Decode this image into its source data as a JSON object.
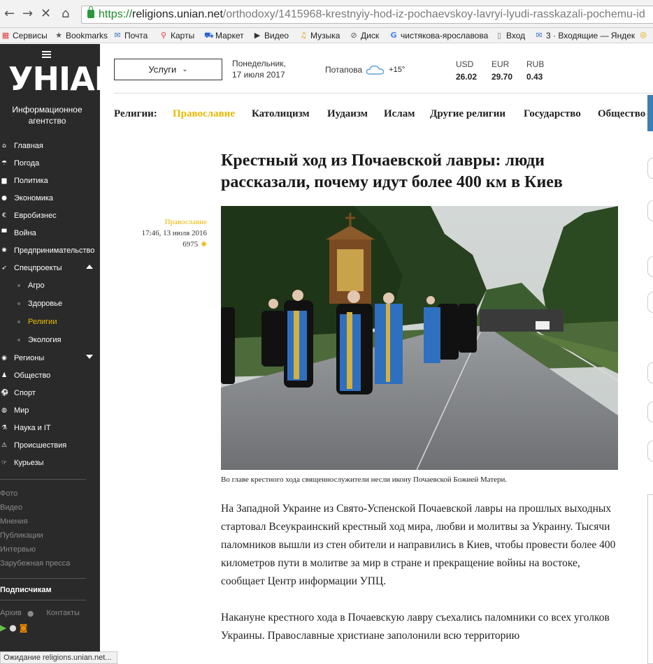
{
  "browser": {
    "url_scheme": "https://",
    "url_host": "religions.unian.net",
    "url_path": "/orthodoxy/1415968-krestnyiy-hod-iz-pochaevskoy-lavryi-lyudi-rasskazali-pochemu-id",
    "bookmarks": [
      "Сервисы",
      "Bookmarks",
      "Почта",
      "Карты",
      "Маркет",
      "Видео",
      "Музыка",
      "Диск",
      "чистякова-ярославова",
      "Вход",
      "3 · Входящие — Яндек"
    ],
    "status": "Ожидание religions.unian.net..."
  },
  "sidebar": {
    "logo": "УНІАН",
    "tagline": "Информационное агентство",
    "items": [
      {
        "label": "Главная",
        "icon": "home-icon",
        "glyph": "⌂"
      },
      {
        "label": "Погода",
        "icon": "umbrella-icon",
        "glyph": "☂"
      },
      {
        "label": "Политика",
        "icon": "building-icon",
        "glyph": "▆"
      },
      {
        "label": "Экономика",
        "icon": "globe-icon",
        "glyph": "●"
      },
      {
        "label": "Евробизнес",
        "icon": "euro-icon",
        "glyph": "€"
      },
      {
        "label": "Война",
        "icon": "briefcase-icon",
        "glyph": "▀"
      },
      {
        "label": "Предпринимательство",
        "icon": "gears-icon",
        "glyph": "✺"
      },
      {
        "label": "Спецпроекты",
        "icon": "rocket-icon",
        "glyph": "➶"
      },
      {
        "label": "Регионы",
        "icon": "compass-icon",
        "glyph": "◉"
      },
      {
        "label": "Общество",
        "icon": "people-icon",
        "glyph": "♟"
      },
      {
        "label": "Спорт",
        "icon": "ball-icon",
        "glyph": "⚽"
      },
      {
        "label": "Мир",
        "icon": "world-icon",
        "glyph": "◍"
      },
      {
        "label": "Наука и IT",
        "icon": "flask-icon",
        "glyph": "⚗"
      },
      {
        "label": "Происшествия",
        "icon": "warning-icon",
        "glyph": "⚠"
      },
      {
        "label": "Курьезы",
        "icon": "thumb-icon",
        "glyph": "☞"
      }
    ],
    "subitems": [
      "Агро",
      "Здоровье",
      "Религии",
      "Экология"
    ],
    "secondary": [
      "Фото",
      "Видео",
      "Мнения",
      "Публикации",
      "Интервью",
      "Зарубежная пресса"
    ],
    "subscribe": "Подписчикам",
    "archive": "Архив",
    "contacts": "Контакты"
  },
  "header": {
    "services": "Услуги",
    "weekday": "Понедельник,",
    "date": "17 июля 2017",
    "city": "Потапова",
    "temp": "+15°",
    "fx": [
      {
        "label": "USD",
        "value": "26.02"
      },
      {
        "label": "EUR",
        "value": "29.70"
      },
      {
        "label": "RUB",
        "value": "0.43"
      }
    ]
  },
  "catnav": {
    "prefix": "Религии:",
    "items": [
      "Православие",
      "Католицизм",
      "Иудаизм",
      "Ислам",
      "Другие религии",
      "Государство",
      "Общество"
    ]
  },
  "article": {
    "title": "Крестный ход из Почаевской лавры: люди рассказали, почему идут более 400 км в Киев",
    "category": "Православие",
    "datetime": "17:46, 13 июля 2016",
    "views": "6975",
    "caption": "Во главе крестного хода священнослужители несли икону Почаевской Божией Матери.",
    "p1": "На Западной Украине из Свято-Успенской Почаевской лавры на прошлых выходных стартовал Всеукраинский крестный ход мира, любви и молитвы за Украину. Тысячи паломников вышли из стен обители и направились в Киев, чтобы провести более 400 километров пути в молитве за мир в стране и прекращение войны на востоке, сообщает Центр информации УПЦ.",
    "p2": "Накануне крестного хода в Почаевскую лавру съехались паломники со всех уголков Украины. Православные христиане заполонили всю территорию"
  },
  "colors": {
    "accent": "#e8b800",
    "sidebar": "#2a2a2a",
    "nav_edge": "#3d7fb3"
  }
}
